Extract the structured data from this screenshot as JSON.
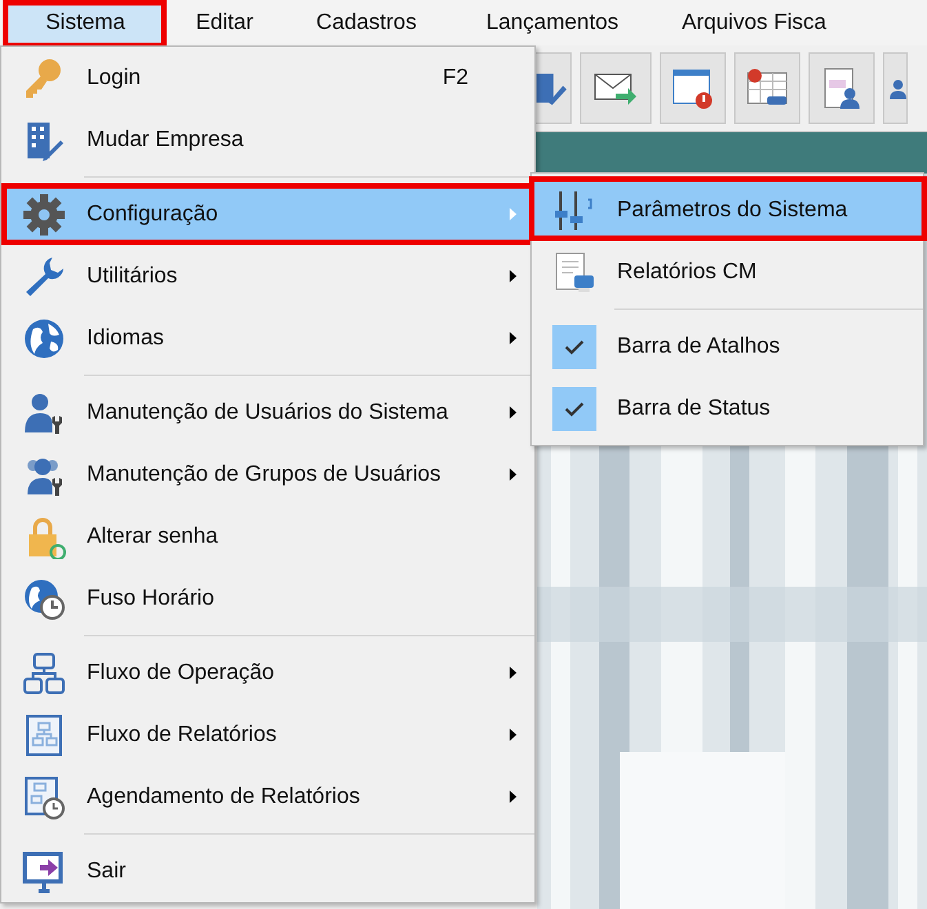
{
  "menubar": [
    {
      "label": "Sistema",
      "selected": true,
      "highlighted": true
    },
    {
      "label": "Editar",
      "selected": false,
      "highlighted": false
    },
    {
      "label": "Cadastros",
      "selected": false,
      "highlighted": false
    },
    {
      "label": "Lançamentos",
      "selected": false,
      "highlighted": false
    },
    {
      "label": "Arquivos Fisca",
      "selected": false,
      "highlighted": false
    }
  ],
  "menu": {
    "items": [
      {
        "kind": "item",
        "label": "Login",
        "shortcut": "F2",
        "submenu": false,
        "selected": false,
        "highlighted": false
      },
      {
        "kind": "item",
        "label": "Mudar Empresa",
        "submenu": false,
        "selected": false,
        "highlighted": false
      },
      {
        "kind": "separator"
      },
      {
        "kind": "item",
        "label": "Configuração",
        "submenu": true,
        "selected": true,
        "highlighted": true
      },
      {
        "kind": "item",
        "label": "Utilitários",
        "submenu": true,
        "selected": false,
        "highlighted": false
      },
      {
        "kind": "item",
        "label": "Idiomas",
        "submenu": true,
        "selected": false,
        "highlighted": false
      },
      {
        "kind": "separator"
      },
      {
        "kind": "item",
        "label": "Manutenção de Usuários do Sistema",
        "submenu": true,
        "selected": false,
        "highlighted": false
      },
      {
        "kind": "item",
        "label": "Manutenção de Grupos de Usuários",
        "submenu": true,
        "selected": false,
        "highlighted": false
      },
      {
        "kind": "item",
        "label": "Alterar senha",
        "submenu": false,
        "selected": false,
        "highlighted": false
      },
      {
        "kind": "item",
        "label": "Fuso Horário",
        "submenu": false,
        "selected": false,
        "highlighted": false
      },
      {
        "kind": "separator"
      },
      {
        "kind": "item",
        "label": "Fluxo de Operação",
        "submenu": true,
        "selected": false,
        "highlighted": false
      },
      {
        "kind": "item",
        "label": "Fluxo de Relatórios",
        "submenu": true,
        "selected": false,
        "highlighted": false
      },
      {
        "kind": "item",
        "label": "Agendamento de Relatórios",
        "submenu": true,
        "selected": false,
        "highlighted": false
      },
      {
        "kind": "separator"
      },
      {
        "kind": "item",
        "label": "Sair",
        "submenu": false,
        "selected": false,
        "highlighted": false
      }
    ]
  },
  "submenu": {
    "items": [
      {
        "kind": "item",
        "label": "Parâmetros do Sistema",
        "selected": true,
        "highlighted": true
      },
      {
        "kind": "item",
        "label": "Relatórios CM",
        "selected": false,
        "highlighted": false
      },
      {
        "kind": "separator"
      },
      {
        "kind": "check",
        "label": "Barra de Atalhos",
        "checked": true
      },
      {
        "kind": "check",
        "label": "Barra de Status",
        "checked": true
      }
    ]
  }
}
